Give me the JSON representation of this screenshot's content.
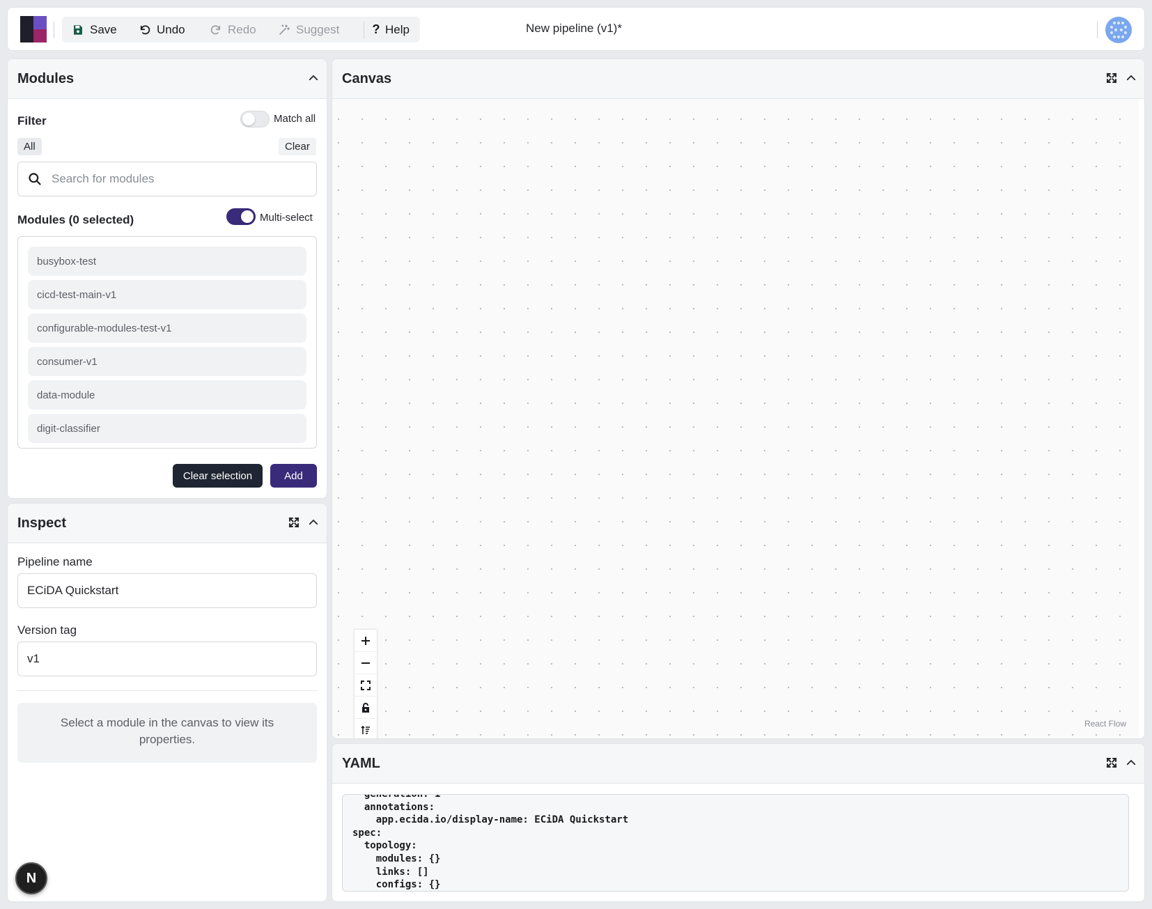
{
  "toolbar": {
    "save": "Save",
    "undo": "Undo",
    "redo": "Redo",
    "suggest": "Suggest",
    "help": "Help",
    "title": "New pipeline (v1)*",
    "save_icon": "floppy-disk-icon",
    "undo_icon": "undo-arrow-icon",
    "redo_icon": "redo-arrow-icon",
    "suggest_icon": "magic-wand-icon",
    "help_icon": "question-mark-icon"
  },
  "modules_panel": {
    "title": "Modules",
    "filter_label": "Filter",
    "match_all_label": "Match all",
    "match_all_on": false,
    "all_chip": "All",
    "clear": "Clear",
    "search_placeholder": "Search for modules",
    "list_title": "Modules (0 selected)",
    "multiselect_label": "Multi-select",
    "multiselect_on": true,
    "items": [
      "busybox-test",
      "cicd-test-main-v1",
      "configurable-modules-test-v1",
      "consumer-v1",
      "data-module",
      "digit-classifier"
    ],
    "clear_selection": "Clear selection",
    "add": "Add"
  },
  "inspect_panel": {
    "title": "Inspect",
    "pipeline_name_label": "Pipeline name",
    "pipeline_name_value": "ECiDA Quickstart",
    "version_tag_label": "Version tag",
    "version_tag_value": "v1",
    "hint": "Select a module in the canvas to view its properties."
  },
  "canvas_panel": {
    "title": "Canvas",
    "attribution": "React Flow",
    "controls": [
      "zoom-in-icon",
      "zoom-out-icon",
      "fit-view-icon",
      "lock-icon",
      "layout-icon"
    ]
  },
  "yaml_panel": {
    "title": "YAML",
    "content": "  generation: 1\n  annotations:\n    app.ecida.io/display-name: ECiDA Quickstart\nspec:\n  topology:\n    modules: {}\n    links: []\n    configs: {}"
  },
  "badge": "N",
  "colors": {
    "accent": "#3a2a7a",
    "dark_button": "#1f2532",
    "logo_dark": "#1e1f2a",
    "logo_purple": "#6b4fc2",
    "logo_magenta": "#9b2566"
  }
}
